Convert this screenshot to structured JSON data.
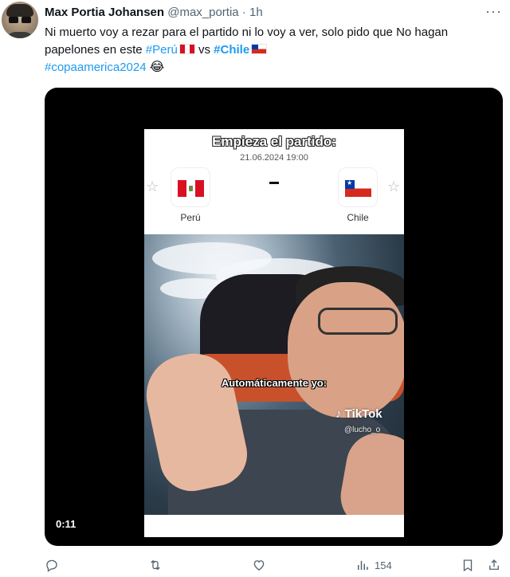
{
  "tweet": {
    "author_name": "Max Portia Johansen",
    "handle": "@max_portia",
    "separator": "·",
    "time": "1h",
    "text_part1": "Ni muerto voy a rezar para el partido ni lo voy a ver, solo pido que No hagan papelones en este ",
    "hashtag_peru": "#Perú",
    "text_vs": " vs ",
    "hashtag_chile": "#Chile",
    "hashtag_copa": "#copaamerica2024",
    "emoji_laugh": "😂",
    "more_label": "···"
  },
  "media": {
    "title": "Empieza el partido:",
    "date": "21.06.2024 19:00",
    "home_team": "Perú",
    "away_team": "Chile",
    "caption": "Automáticamente yo:",
    "watermark_brand": "TikTok",
    "watermark_user": "@lucho_o",
    "duration": "0:11"
  },
  "actions": {
    "reply_icon": "reply-icon",
    "retweet_icon": "retweet-icon",
    "like_icon": "like-icon",
    "views_icon": "views-icon",
    "views_count": "154",
    "bookmark_icon": "bookmark-icon",
    "share_icon": "share-icon"
  },
  "colors": {
    "accent": "#1d9bf0",
    "text": "#0f1419",
    "muted": "#536471"
  }
}
